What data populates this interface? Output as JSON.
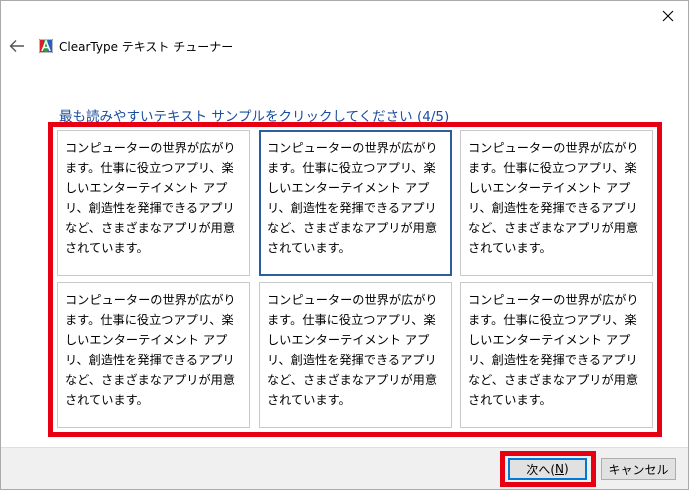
{
  "window": {
    "app_title": "ClearType テキスト チューナー",
    "icons": {
      "back": "back-arrow-icon",
      "app": "cleartype-app-icon",
      "close": "close-icon"
    }
  },
  "main": {
    "instruction": "最も読みやすいテキスト サンプルをクリックしてください (4/5)",
    "samples": [
      {
        "text": "コンピューターの世界が広がります。仕事に役立つアプリ、楽しいエンターテイメント アプリ、創造性を発揮できるアプリなど、さまざまなアプリが用意されています。",
        "selected": false
      },
      {
        "text": "コンピューターの世界が広がります。仕事に役立つアプリ、楽しいエンターテイメント アプリ、創造性を発揮できるアプリなど、さまざまなアプリが用意されています。",
        "selected": true
      },
      {
        "text": "コンピューターの世界が広がります。仕事に役立つアプリ、楽しいエンターテイメント アプリ、創造性を発揮できるアプリなど、さまざまなアプリが用意されています。",
        "selected": false
      },
      {
        "text": "コンピューターの世界が広がります。仕事に役立つアプリ、楽しいエンターテイメント アプリ、創造性を発揮できるアプリなど、さまざまなアプリが用意されています。",
        "selected": false
      },
      {
        "text": "コンピューターの世界が広がります。仕事に役立つアプリ、楽しいエンターテイメント アプリ、創造性を発揮できるアプリなど、さまざまなアプリが用意されています。",
        "selected": false
      },
      {
        "text": "コンピューターの世界が広がります。仕事に役立つアプリ、楽しいエンターテイメント アプリ、創造性を発揮できるアプリなど、さまざまなアプリが用意されています。",
        "selected": false
      }
    ]
  },
  "footer": {
    "next_label": "次へ(",
    "next_key": "N",
    "next_suffix": ")",
    "cancel_label": "キャンセル"
  },
  "colors": {
    "accent": "#1a4d9e",
    "highlight": "#e60012",
    "selection_border": "#2a5f9e",
    "footer_bg": "#f0f0f0"
  }
}
